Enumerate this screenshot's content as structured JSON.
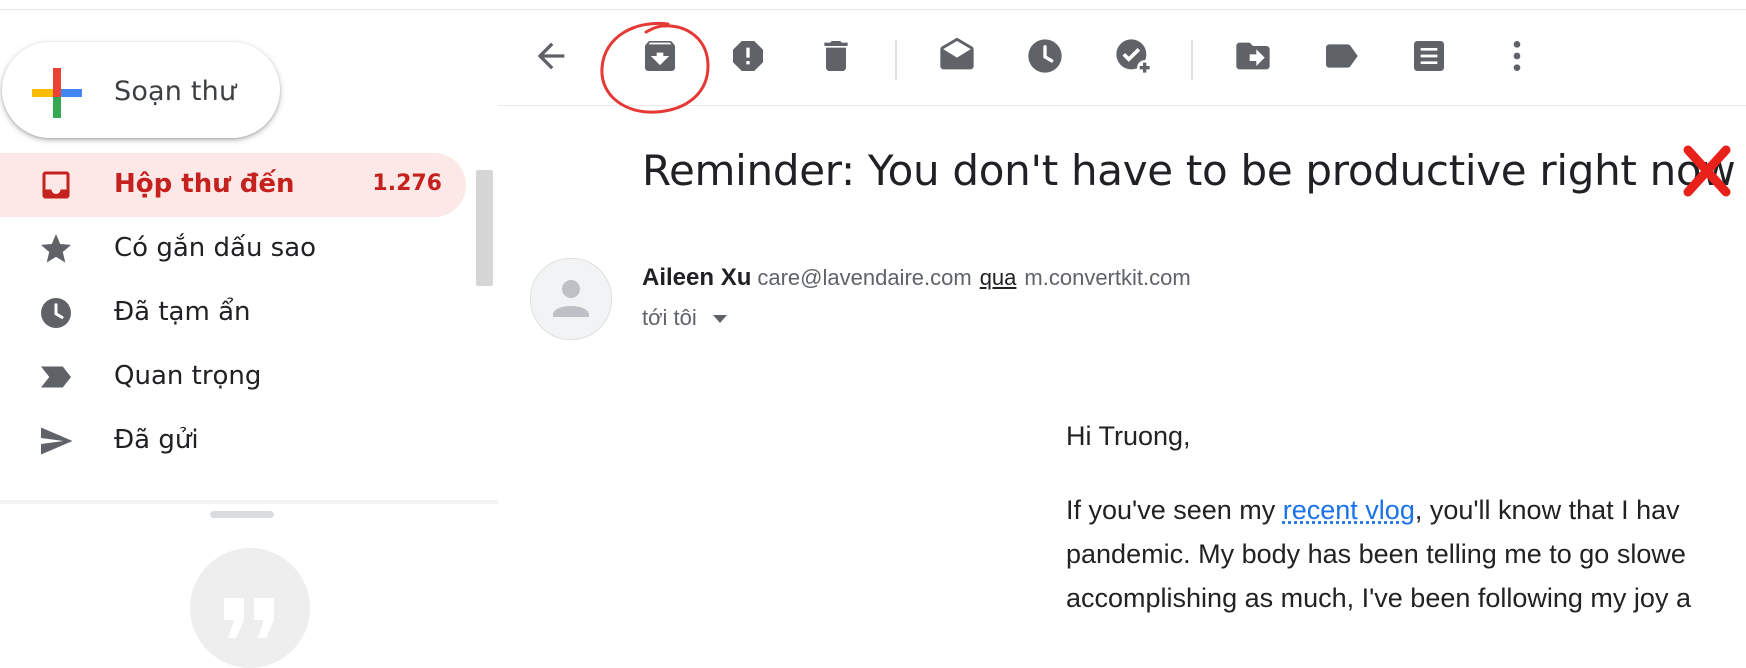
{
  "compose": {
    "label": "Soạn thư"
  },
  "sidebar": {
    "items": [
      {
        "label": "Hộp thư đến",
        "count": "1.276",
        "icon": "inbox-icon"
      },
      {
        "label": "Có gắn dấu sao",
        "icon": "star-icon"
      },
      {
        "label": "Đã tạm ẩn",
        "icon": "clock-icon"
      },
      {
        "label": "Quan trọng",
        "icon": "important-icon"
      },
      {
        "label": "Đã gửi",
        "icon": "send-icon"
      }
    ]
  },
  "toolbar": {
    "buttons": [
      "back-icon",
      "archive-icon",
      "report-spam-icon",
      "delete-icon",
      "mark-unread-icon",
      "snooze-icon",
      "add-to-tasks-icon",
      "move-to-icon",
      "label-icon",
      "more-actions-icon",
      "more-vert-icon"
    ]
  },
  "message": {
    "subject": "Reminder: You don't have to be productive right now",
    "sender_name": "Aileen Xu",
    "sender_email": "care@lavendaire.com",
    "via": "qua",
    "via_domain": "m.convertkit.com",
    "recipient": "tới tôi",
    "greeting": "Hi Truong,",
    "line1_before": "If you've seen my ",
    "line1_link": "recent vlog",
    "line1_after": ", you'll know that I hav",
    "line2": "pandemic. My body has been telling me to go slowe",
    "line3": "accomplishing as much, I've been following my joy a"
  },
  "colors": {
    "accent_red": "#c5221f",
    "active_bg": "#fce8e6",
    "link": "#1a73e8",
    "annotation_circle": "#e53935"
  }
}
